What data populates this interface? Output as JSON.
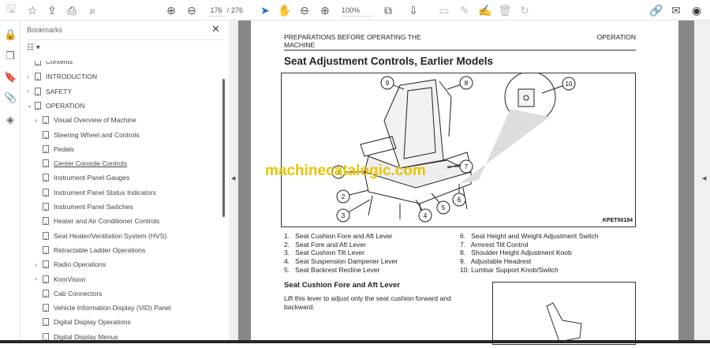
{
  "toolbar": {
    "page_current": "176",
    "page_total": "/ 276",
    "zoom": "100%",
    "icons": [
      "save-icon",
      "star-icon",
      "cloud-upload-icon",
      "print-icon",
      "zoom-search-icon",
      "page-up-icon",
      "page-down-icon",
      "select-cursor-icon",
      "hand-icon",
      "zoom-out-icon",
      "zoom-in-icon",
      "fit-page-icon",
      "scroll-mode-icon",
      "comment-icon",
      "pen-icon",
      "sign-icon",
      "trash-icon",
      "redo-icon",
      "share-link-icon",
      "email-icon",
      "account-icon"
    ]
  },
  "rail": {
    "icons": [
      "lock-icon",
      "pages-icon",
      "bookmark-icon",
      "attachment-icon",
      "layers-icon"
    ]
  },
  "bookmarks": {
    "title": "Bookmarks",
    "items": [
      {
        "label": "Contents",
        "level": 0,
        "chevron": ""
      },
      {
        "label": "INTRODUCTION",
        "level": 0,
        "chevron": "›"
      },
      {
        "label": "SAFETY",
        "level": 0,
        "chevron": "›"
      },
      {
        "label": "OPERATION",
        "level": 0,
        "chevron": "⌄"
      },
      {
        "label": "Visual Overview of Machine",
        "level": 1,
        "chevron": "›"
      },
      {
        "label": "Steering Wheel and Controls",
        "level": 1,
        "chevron": ""
      },
      {
        "label": "Pedals",
        "level": 1,
        "chevron": ""
      },
      {
        "label": "Center Console Controls",
        "level": 1,
        "chevron": "",
        "selected": true
      },
      {
        "label": "Instrument Panel Gauges",
        "level": 1,
        "chevron": ""
      },
      {
        "label": "Instrument Panel Status Indicators",
        "level": 1,
        "chevron": ""
      },
      {
        "label": "Instrument Panel Switches",
        "level": 1,
        "chevron": ""
      },
      {
        "label": "Heater and Air Conditioner Controls",
        "level": 1,
        "chevron": ""
      },
      {
        "label": "Seat Heater/Ventilation System (HVS)",
        "level": 1,
        "chevron": ""
      },
      {
        "label": "Retractable Ladder Operations",
        "level": 1,
        "chevron": ""
      },
      {
        "label": "Radio Operations",
        "level": 1,
        "chevron": "›"
      },
      {
        "label": "KomVision",
        "level": 1,
        "chevron": "›"
      },
      {
        "label": "Cab Connectors",
        "level": 1,
        "chevron": ""
      },
      {
        "label": "Vehicle Information Display (VID) Panel",
        "level": 1,
        "chevron": ""
      },
      {
        "label": "Digital Display Operations",
        "level": 1,
        "chevron": ""
      },
      {
        "label": "Digital Display Menus",
        "level": 1,
        "chevron": ""
      }
    ]
  },
  "document": {
    "header_left_1": "PREPARATIONS BEFORE OPERATING THE",
    "header_left_2": "MACHINE",
    "header_right": "OPERATION",
    "title": "Seat Adjustment Controls, Earlier Models",
    "figure_code": "KPET00184",
    "watermark": "machinecatalogic.com",
    "callouts": [
      "1",
      "2",
      "3",
      "4",
      "5",
      "6",
      "7",
      "8",
      "9",
      "10"
    ],
    "legend_left": [
      "1.   Seat Cushion Fore and Aft Lever",
      "2.   Seat Fore and Aft Lever",
      "3.   Seat Cushion Tilt Lever",
      "4.   Seat Suspension Dampener Lever",
      "5.   Seat Backrest Recline Lever"
    ],
    "legend_right": [
      "6.   Seat Height and Weight Adjustment Switch",
      "7.   Armrest Tilt Control",
      "8.   Shoulder Height Adjustment Knob",
      "9.   Adjustable Headrest",
      "10. Lumbar Support Knob/Switch"
    ],
    "section_heading": "Seat Cushion Fore and Aft Lever",
    "paragraph_1": "Lift this lever to adjust only the seat cushion forward and",
    "paragraph_2": "backward."
  },
  "colors": {
    "accent": "#1a73c8",
    "watermark": "#e8c400"
  }
}
